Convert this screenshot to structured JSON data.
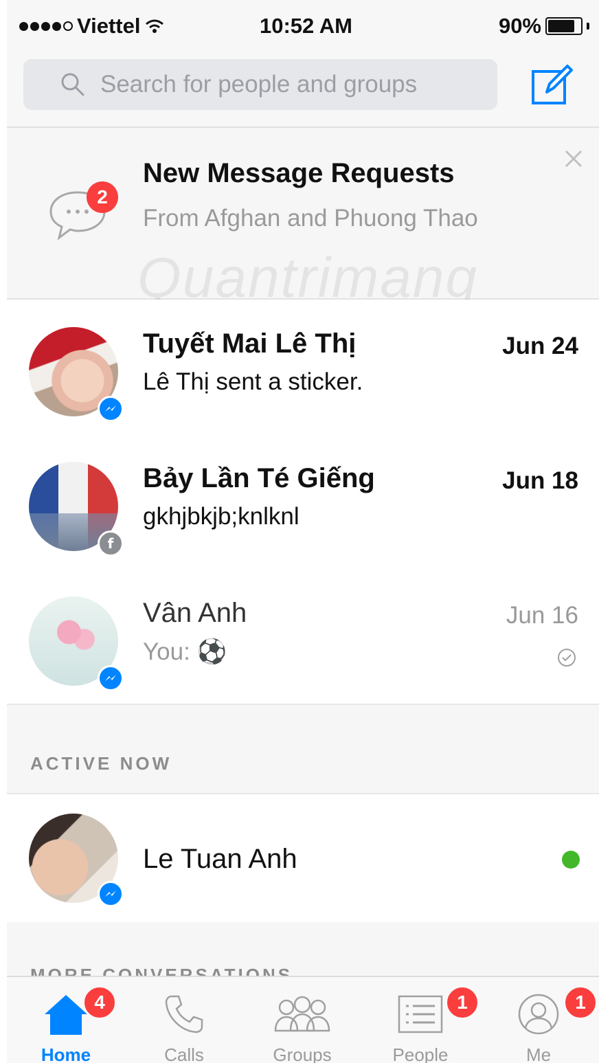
{
  "status_bar": {
    "carrier": "Viettel",
    "time": "10:52 AM",
    "battery": "90%",
    "battery_level": 0.9
  },
  "search": {
    "placeholder": "Search for people and groups"
  },
  "message_requests": {
    "title": "New Message Requests",
    "subtitle": "From Afghan and Phuong Thao",
    "badge": "2"
  },
  "conversations": [
    {
      "name": "Tuyết Mai Lê Thị",
      "preview": "Lê Thị sent a sticker.",
      "date": "Jun 24",
      "unread": true,
      "source": "messenger"
    },
    {
      "name": "Bảy Lần Té Giếng",
      "preview": "gkhjbkjb;knlknl",
      "date": "Jun 18",
      "unread": true,
      "source": "facebook"
    },
    {
      "name": "Vân Anh",
      "preview": "You: ⚽",
      "date": "Jun 16",
      "unread": false,
      "source": "messenger"
    }
  ],
  "active_now": {
    "label": "ACTIVE NOW",
    "people": [
      {
        "name": "Le Tuan Anh",
        "online": true
      }
    ]
  },
  "more_conversations_label": "MORE CONVERSATIONS",
  "watermark": "Quantrimang",
  "tabbar": {
    "tabs": [
      {
        "label": "Home",
        "badge": "4",
        "active": true
      },
      {
        "label": "Calls",
        "badge": ""
      },
      {
        "label": "Groups",
        "badge": ""
      },
      {
        "label": "People",
        "badge": "1"
      },
      {
        "label": "Me",
        "badge": "1"
      }
    ]
  },
  "colors": {
    "accent": "#0084ff",
    "badge": "#fa3e3e",
    "online": "#42b72a"
  }
}
